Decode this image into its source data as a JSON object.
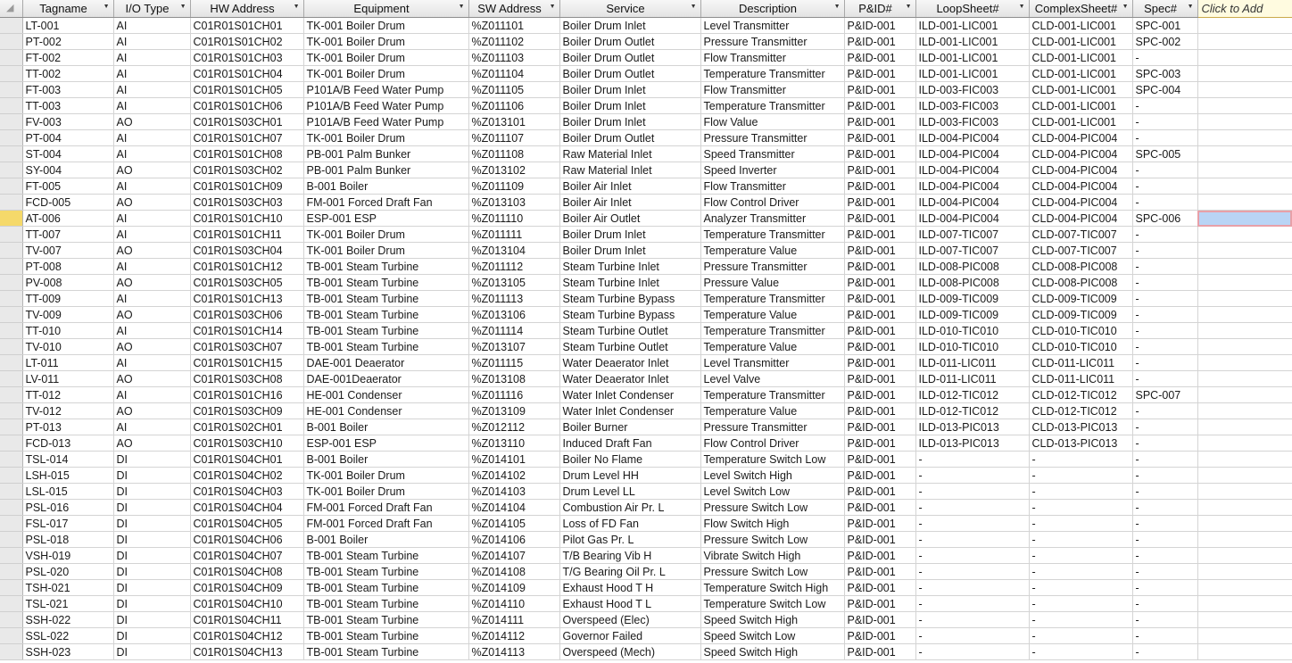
{
  "columns": [
    "Tagname",
    "I/O Type",
    "HW Address",
    "Equipment",
    "SW Address",
    "Service",
    "Description",
    "P&ID#",
    "LoopSheet#",
    "ComplexSheet#",
    "Spec#"
  ],
  "add_column_label": "Click to Add",
  "current_row_index": 12,
  "rows": [
    [
      "LT-001",
      "AI",
      "C01R01S01CH01",
      "TK-001 Boiler Drum",
      "%Z011101",
      "Boiler Drum Inlet",
      "Level Transmitter",
      "P&ID-001",
      "ILD-001-LIC001",
      "CLD-001-LIC001",
      "SPC-001"
    ],
    [
      "PT-002",
      "AI",
      "C01R01S01CH02",
      "TK-001 Boiler Drum",
      "%Z011102",
      "Boiler Drum Outlet",
      "Pressure Transmitter",
      "P&ID-001",
      "ILD-001-LIC001",
      "CLD-001-LIC001",
      "SPC-002"
    ],
    [
      "FT-002",
      "AI",
      "C01R01S01CH03",
      "TK-001 Boiler Drum",
      "%Z011103",
      "Boiler Drum Outlet",
      "Flow Transmitter",
      "P&ID-001",
      "ILD-001-LIC001",
      "CLD-001-LIC001",
      "-"
    ],
    [
      "TT-002",
      "AI",
      "C01R01S01CH04",
      "TK-001 Boiler Drum",
      "%Z011104",
      "Boiler Drum Outlet",
      "Temperature Transmitter",
      "P&ID-001",
      "ILD-001-LIC001",
      "CLD-001-LIC001",
      "SPC-003"
    ],
    [
      "FT-003",
      "AI",
      "C01R01S01CH05",
      "P101A/B Feed Water Pump",
      "%Z011105",
      "Boiler Drum Inlet",
      "Flow Transmitter",
      "P&ID-001",
      "ILD-003-FIC003",
      "CLD-001-LIC001",
      "SPC-004"
    ],
    [
      "TT-003",
      "AI",
      "C01R01S01CH06",
      "P101A/B Feed Water Pump",
      "%Z011106",
      "Boiler Drum Inlet",
      "Temperature Transmitter",
      "P&ID-001",
      "ILD-003-FIC003",
      "CLD-001-LIC001",
      "-"
    ],
    [
      "FV-003",
      "AO",
      "C01R01S03CH01",
      "P101A/B Feed Water Pump",
      "%Z013101",
      "Boiler Drum Inlet",
      "Flow Value",
      "P&ID-001",
      "ILD-003-FIC003",
      "CLD-001-LIC001",
      "-"
    ],
    [
      "PT-004",
      "AI",
      "C01R01S01CH07",
      "TK-001 Boiler Drum",
      "%Z011107",
      "Boiler Drum Outlet",
      "Pressure Transmitter",
      "P&ID-001",
      "ILD-004-PIC004",
      "CLD-004-PIC004",
      "-"
    ],
    [
      "ST-004",
      "AI",
      "C01R01S01CH08",
      "PB-001 Palm Bunker",
      "%Z011108",
      "Raw Material Inlet",
      "Speed Transmitter",
      "P&ID-001",
      "ILD-004-PIC004",
      "CLD-004-PIC004",
      "SPC-005"
    ],
    [
      "SY-004",
      "AO",
      "C01R01S03CH02",
      "PB-001 Palm Bunker",
      "%Z013102",
      "Raw Material Inlet",
      "Speed Inverter",
      "P&ID-001",
      "ILD-004-PIC004",
      "CLD-004-PIC004",
      "-"
    ],
    [
      "FT-005",
      "AI",
      "C01R01S01CH09",
      "B-001 Boiler",
      "%Z011109",
      "Boiler Air Inlet",
      "Flow Transmitter",
      "P&ID-001",
      "ILD-004-PIC004",
      "CLD-004-PIC004",
      "-"
    ],
    [
      "FCD-005",
      "AO",
      "C01R01S03CH03",
      "FM-001 Forced Draft Fan",
      "%Z013103",
      "Boiler Air Inlet",
      "Flow Control Driver",
      "P&ID-001",
      "ILD-004-PIC004",
      "CLD-004-PIC004",
      "-"
    ],
    [
      "AT-006",
      "AI",
      "C01R01S01CH10",
      "ESP-001 ESP",
      "%Z011110",
      "Boiler Air Outlet",
      "Analyzer Transmitter",
      "P&ID-001",
      "ILD-004-PIC004",
      "CLD-004-PIC004",
      "SPC-006"
    ],
    [
      "TT-007",
      "AI",
      "C01R01S01CH11",
      "TK-001 Boiler Drum",
      "%Z011111",
      "Boiler Drum Inlet",
      "Temperature Transmitter",
      "P&ID-001",
      "ILD-007-TIC007",
      "CLD-007-TIC007",
      "-"
    ],
    [
      "TV-007",
      "AO",
      "C01R01S03CH04",
      "TK-001 Boiler Drum",
      "%Z013104",
      "Boiler Drum Inlet",
      "Temperature Value",
      "P&ID-001",
      "ILD-007-TIC007",
      "CLD-007-TIC007",
      "-"
    ],
    [
      "PT-008",
      "AI",
      "C01R01S01CH12",
      "TB-001 Steam Turbine",
      "%Z011112",
      "Steam Turbine Inlet",
      "Pressure Transmitter",
      "P&ID-001",
      "ILD-008-PIC008",
      "CLD-008-PIC008",
      "-"
    ],
    [
      "PV-008",
      "AO",
      "C01R01S03CH05",
      "TB-001 Steam Turbine",
      "%Z013105",
      "Steam Turbine Inlet",
      "Pressure Value",
      "P&ID-001",
      "ILD-008-PIC008",
      "CLD-008-PIC008",
      "-"
    ],
    [
      "TT-009",
      "AI",
      "C01R01S01CH13",
      "TB-001 Steam Turbine",
      "%Z011113",
      "Steam Turbine Bypass",
      "Temperature Transmitter",
      "P&ID-001",
      "ILD-009-TIC009",
      "CLD-009-TIC009",
      "-"
    ],
    [
      "TV-009",
      "AO",
      "C01R01S03CH06",
      "TB-001 Steam Turbine",
      "%Z013106",
      "Steam Turbine Bypass",
      "Temperature Value",
      "P&ID-001",
      "ILD-009-TIC009",
      "CLD-009-TIC009",
      "-"
    ],
    [
      "TT-010",
      "AI",
      "C01R01S01CH14",
      "TB-001 Steam Turbine",
      "%Z011114",
      "Steam Turbine Outlet",
      "Temperature Transmitter",
      "P&ID-001",
      "ILD-010-TIC010",
      "CLD-010-TIC010",
      "-"
    ],
    [
      "TV-010",
      "AO",
      "C01R01S03CH07",
      "TB-001 Steam Turbine",
      "%Z013107",
      "Steam Turbine Outlet",
      "Temperature Value",
      "P&ID-001",
      "ILD-010-TIC010",
      "CLD-010-TIC010",
      "-"
    ],
    [
      "LT-011",
      "AI",
      "C01R01S01CH15",
      "DAE-001 Deaerator",
      "%Z011115",
      "Water Deaerator Inlet",
      "Level Transmitter",
      "P&ID-001",
      "ILD-011-LIC011",
      "CLD-011-LIC011",
      "-"
    ],
    [
      "LV-011",
      "AO",
      "C01R01S03CH08",
      "DAE-001Deaerator",
      "%Z013108",
      "Water Deaerator Inlet",
      "Level Valve",
      "P&ID-001",
      "ILD-011-LIC011",
      "CLD-011-LIC011",
      "-"
    ],
    [
      "TT-012",
      "AI",
      "C01R01S01CH16",
      "HE-001 Condenser",
      "%Z011116",
      "Water Inlet Condenser",
      "Temperature Transmitter",
      "P&ID-001",
      "ILD-012-TIC012",
      "CLD-012-TIC012",
      "SPC-007"
    ],
    [
      "TV-012",
      "AO",
      "C01R01S03CH09",
      "HE-001 Condenser",
      "%Z013109",
      "Water Inlet Condenser",
      "Temperature Value",
      "P&ID-001",
      "ILD-012-TIC012",
      "CLD-012-TIC012",
      "-"
    ],
    [
      "PT-013",
      "AI",
      "C01R01S02CH01",
      "B-001 Boiler",
      "%Z012112",
      "Boiler Burner",
      "Pressure Transmitter",
      "P&ID-001",
      "ILD-013-PIC013",
      "CLD-013-PIC013",
      "-"
    ],
    [
      "FCD-013",
      "AO",
      "C01R01S03CH10",
      "ESP-001 ESP",
      "%Z013110",
      "Induced Draft Fan",
      "Flow Control Driver",
      "P&ID-001",
      "ILD-013-PIC013",
      "CLD-013-PIC013",
      "-"
    ],
    [
      "TSL-014",
      "DI",
      "C01R01S04CH01",
      "B-001 Boiler",
      "%Z014101",
      "Boiler No Flame",
      "Temperature Switch Low",
      "P&ID-001",
      "-",
      "-",
      "-"
    ],
    [
      "LSH-015",
      "DI",
      "C01R01S04CH02",
      "TK-001 Boiler Drum",
      "%Z014102",
      "Drum Level HH",
      "Level Switch High",
      "P&ID-001",
      "-",
      "-",
      "-"
    ],
    [
      "LSL-015",
      "DI",
      "C01R01S04CH03",
      "TK-001 Boiler Drum",
      "%Z014103",
      "Drum Level LL",
      "Level Switch Low",
      "P&ID-001",
      "-",
      "-",
      "-"
    ],
    [
      "PSL-016",
      "DI",
      "C01R01S04CH04",
      "FM-001 Forced Draft Fan",
      "%Z014104",
      "Combustion Air Pr. L",
      "Pressure Switch Low",
      "P&ID-001",
      "-",
      "-",
      "-"
    ],
    [
      "FSL-017",
      "DI",
      "C01R01S04CH05",
      "FM-001 Forced Draft Fan",
      "%Z014105",
      "Loss of FD Fan",
      "Flow  Switch High",
      "P&ID-001",
      "-",
      "-",
      "-"
    ],
    [
      "PSL-018",
      "DI",
      "C01R01S04CH06",
      "B-001 Boiler",
      "%Z014106",
      "Pilot Gas Pr. L",
      "Pressure Switch Low",
      "P&ID-001",
      "-",
      "-",
      "-"
    ],
    [
      "VSH-019",
      "DI",
      "C01R01S04CH07",
      "TB-001 Steam Turbine",
      "%Z014107",
      "T/B Bearing Vib H",
      "Vibrate Switch High",
      "P&ID-001",
      "-",
      "-",
      "-"
    ],
    [
      "PSL-020",
      "DI",
      "C01R01S04CH08",
      "TB-001 Steam Turbine",
      "%Z014108",
      "T/G Bearing Oil Pr. L",
      "Pressure Switch Low",
      "P&ID-001",
      "-",
      "-",
      "-"
    ],
    [
      "TSH-021",
      "DI",
      "C01R01S04CH09",
      "TB-001 Steam Turbine",
      "%Z014109",
      "Exhaust Hood T H",
      "Temperature Switch High",
      "P&ID-001",
      "-",
      "-",
      "-"
    ],
    [
      "TSL-021",
      "DI",
      "C01R01S04CH10",
      "TB-001 Steam Turbine",
      "%Z014110",
      "Exhaust Hood T L",
      "Temperature Switch Low",
      "P&ID-001",
      "-",
      "-",
      "-"
    ],
    [
      "SSH-022",
      "DI",
      "C01R01S04CH11",
      "TB-001 Steam Turbine",
      "%Z014111",
      "Overspeed (Elec)",
      "Speed Switch High",
      "P&ID-001",
      "-",
      "-",
      "-"
    ],
    [
      "SSL-022",
      "DI",
      "C01R01S04CH12",
      "TB-001 Steam Turbine",
      "%Z014112",
      "Governor Failed",
      "Speed Switch Low",
      "P&ID-001",
      "-",
      "-",
      "-"
    ],
    [
      "SSH-023",
      "DI",
      "C01R01S04CH13",
      "TB-001 Steam Turbine",
      "%Z014113",
      "Overspeed (Mech)",
      "Speed Switch High",
      "P&ID-001",
      "-",
      "-",
      "-"
    ]
  ]
}
